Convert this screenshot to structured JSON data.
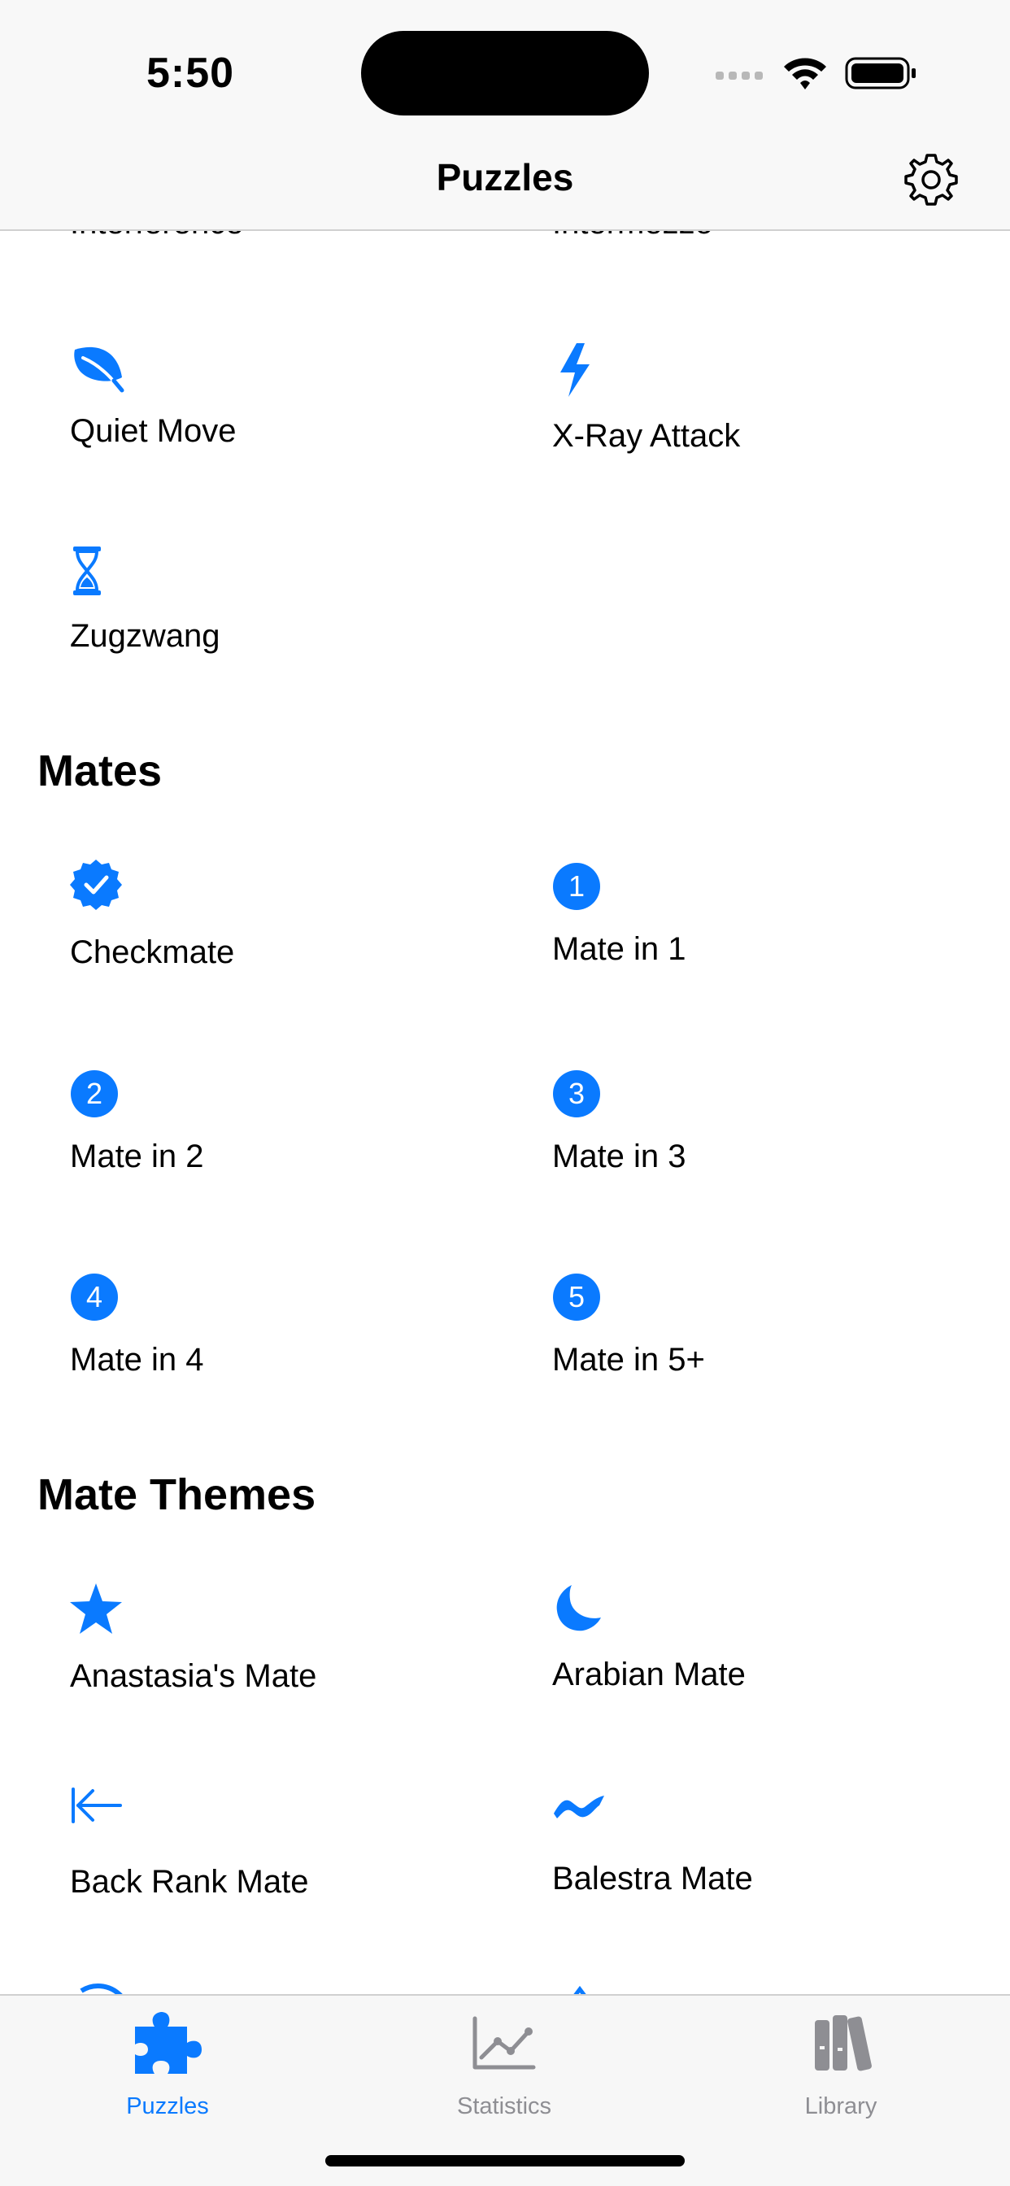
{
  "status_bar": {
    "time": "5:50"
  },
  "nav": {
    "title": "Puzzles"
  },
  "partial_top": {
    "left": "Interference",
    "right": "Intermezzo"
  },
  "tactics_items": [
    {
      "label": "Quiet Move",
      "icon": "leaf-icon"
    },
    {
      "label": "X-Ray Attack",
      "icon": "bolt-icon"
    },
    {
      "label": "Zugzwang",
      "icon": "hourglass-icon"
    }
  ],
  "mates": {
    "title": "Mates",
    "items": [
      {
        "label": "Checkmate",
        "icon": "checkmark-seal-icon"
      },
      {
        "label": "Mate in 1",
        "icon": "number-1-icon",
        "badge": "1"
      },
      {
        "label": "Mate in 2",
        "icon": "number-2-icon",
        "badge": "2"
      },
      {
        "label": "Mate in 3",
        "icon": "number-3-icon",
        "badge": "3"
      },
      {
        "label": "Mate in 4",
        "icon": "number-4-icon",
        "badge": "4"
      },
      {
        "label": "Mate in 5+",
        "icon": "number-5-icon",
        "badge": "5"
      }
    ]
  },
  "mate_themes": {
    "title": "Mate Themes",
    "items": [
      {
        "label": "Anastasia's Mate",
        "icon": "star-icon"
      },
      {
        "label": "Arabian Mate",
        "icon": "moon-icon"
      },
      {
        "label": "Back Rank Mate",
        "icon": "arrow-left-to-line-icon"
      },
      {
        "label": "Balestra Mate",
        "icon": "wave-icon"
      }
    ]
  },
  "tabbar": {
    "tabs": [
      {
        "label": "Puzzles",
        "icon": "puzzle-piece-icon",
        "selected": true
      },
      {
        "label": "Statistics",
        "icon": "chart-icon",
        "selected": false
      },
      {
        "label": "Library",
        "icon": "books-icon",
        "selected": false
      }
    ]
  },
  "colors": {
    "accent": "#0a7aff",
    "tab_inactive": "#8e8e93",
    "bar_background": "#f7f7f7"
  }
}
